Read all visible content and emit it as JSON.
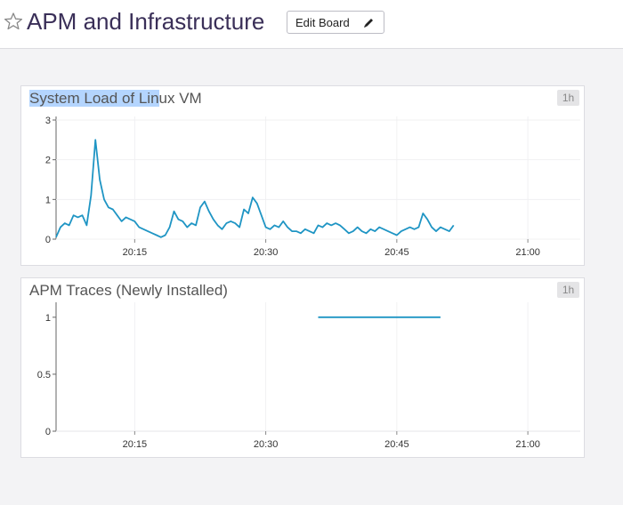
{
  "header": {
    "title": "APM and Infrastructure",
    "edit_label": "Edit Board"
  },
  "widgets": [
    {
      "title_selected": "System Load of Lin",
      "title_rest": "ux VM",
      "badge": "1h",
      "chart_data": {
        "type": "line",
        "title": "System Load of Linux VM",
        "x_ticks": [
          "20:15",
          "20:30",
          "20:45",
          "21:00"
        ],
        "y_ticks": [
          "0",
          "1",
          "2",
          "3"
        ],
        "ylim": [
          0,
          3
        ],
        "xlim": [
          "20:06",
          "21:06"
        ],
        "grid": true,
        "series": [
          {
            "x": [
              "20:06",
              "20:06.5",
              "20:07",
              "20:07.5",
              "20:08",
              "20:08.5",
              "20:09",
              "20:09.5",
              "20:10",
              "20:10.5",
              "20:11",
              "20:11.5",
              "20:12",
              "20:12.5",
              "20:13",
              "20:13.5",
              "20:14",
              "20:14.5",
              "20:15",
              "20:15.5",
              "20:16",
              "20:16.5",
              "20:17",
              "20:17.5",
              "20:18",
              "20:18.5",
              "20:19",
              "20:19.5",
              "20:20",
              "20:20.5",
              "20:21",
              "20:21.5",
              "20:22",
              "20:22.5",
              "20:23",
              "20:23.5",
              "20:24",
              "20:24.5",
              "20:25",
              "20:25.5",
              "20:26",
              "20:26.5",
              "20:27",
              "20:27.5",
              "20:28",
              "20:28.5",
              "20:29",
              "20:29.5",
              "20:30",
              "20:30.5",
              "20:31",
              "20:31.5",
              "20:32",
              "20:32.5",
              "20:33",
              "20:33.5",
              "20:34",
              "20:34.5",
              "20:35",
              "20:35.5",
              "20:36",
              "20:36.5",
              "20:37",
              "20:37.5",
              "20:38",
              "20:38.5",
              "20:39",
              "20:39.5",
              "20:40",
              "20:40.5",
              "20:41",
              "20:41.5",
              "20:42",
              "20:42.5",
              "20:43",
              "20:43.5",
              "20:44",
              "20:44.5",
              "20:45",
              "20:45.5",
              "20:46",
              "20:46.5",
              "20:47",
              "20:47.5",
              "20:48",
              "20:48.5",
              "20:49",
              "20:49.5",
              "20:50",
              "20:50.5",
              "20:51",
              "20:51.5"
            ],
            "values": [
              0.05,
              0.3,
              0.4,
              0.35,
              0.6,
              0.55,
              0.6,
              0.35,
              1.1,
              2.5,
              1.5,
              1.0,
              0.8,
              0.75,
              0.6,
              0.45,
              0.55,
              0.5,
              0.45,
              0.3,
              0.25,
              0.2,
              0.15,
              0.1,
              0.05,
              0.1,
              0.3,
              0.7,
              0.5,
              0.45,
              0.3,
              0.4,
              0.35,
              0.8,
              0.95,
              0.7,
              0.5,
              0.35,
              0.25,
              0.4,
              0.45,
              0.4,
              0.3,
              0.75,
              0.65,
              1.05,
              0.9,
              0.6,
              0.3,
              0.25,
              0.35,
              0.3,
              0.45,
              0.3,
              0.2,
              0.2,
              0.15,
              0.25,
              0.2,
              0.15,
              0.35,
              0.3,
              0.4,
              0.35,
              0.4,
              0.35,
              0.25,
              0.15,
              0.2,
              0.3,
              0.2,
              0.15,
              0.25,
              0.2,
              0.3,
              0.25,
              0.2,
              0.15,
              0.1,
              0.2,
              0.25,
              0.3,
              0.25,
              0.3,
              0.65,
              0.5,
              0.3,
              0.2,
              0.3,
              0.25,
              0.2,
              0.35,
              0.3,
              0.4,
              0.2,
              0.5,
              0.95,
              0.8,
              0.5,
              0.7,
              0.45,
              0.35
            ]
          }
        ]
      }
    },
    {
      "title": "APM Traces (Newly Installed)",
      "badge": "1h",
      "chart_data": {
        "type": "line",
        "title": "APM Traces (Newly Installed)",
        "x_ticks": [
          "20:15",
          "20:30",
          "20:45",
          "21:00"
        ],
        "y_ticks": [
          "0",
          "0.5",
          "1"
        ],
        "ylim": [
          0,
          1.1
        ],
        "xlim": [
          "20:06",
          "21:06"
        ],
        "grid": false,
        "series": [
          {
            "x": [
              "20:36",
              "20:50"
            ],
            "values": [
              1,
              1
            ]
          }
        ]
      }
    }
  ],
  "colors": {
    "line": "#1f95c4",
    "title": "#3a2f58",
    "selection": "#b4d5fe"
  },
  "icons": {
    "favorite": "star-icon",
    "edit": "pencil-icon"
  }
}
